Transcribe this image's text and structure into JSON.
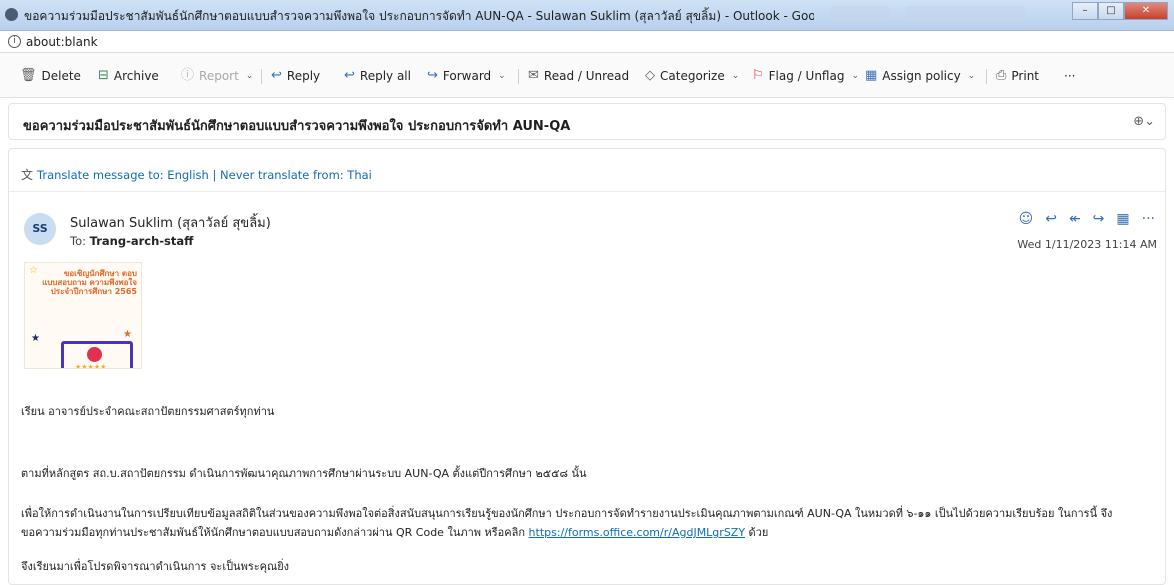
{
  "window": {
    "title": "ขอความร่วมมือประชาสัมพันธ์นักศึกษาตอบแบบสำรวจความพึงพอใจ ประกอบการจัดทำ AUN-QA - Sulawan Suklim (สุลาวัลย์ สุขลิ้ม) - Outlook - Google Chrome",
    "url": "about:blank"
  },
  "toolbar": {
    "delete": "Delete",
    "archive": "Archive",
    "report": "Report",
    "reply": "Reply",
    "reply_all": "Reply all",
    "forward": "Forward",
    "read_unread": "Read / Unread",
    "categorize": "Categorize",
    "flag": "Flag / Unflag",
    "assign_policy": "Assign policy",
    "print": "Print",
    "more": "···"
  },
  "subject": "ขอความร่วมมือประชาสัมพันธ์นักศึกษาตอบแบบสำรวจความพึงพอใจ ประกอบการจัดทำ AUN-QA",
  "translate": {
    "prefix": "Translate message to: English",
    "separator": " | ",
    "never": "Never translate from: Thai"
  },
  "message": {
    "avatar_initials": "SS",
    "sender": "Sulawan Suklim (สุลาวัลย์ สุขลิ้ม)",
    "to_label": "To:",
    "to": "Trang-arch-staff",
    "date": "Wed 1/11/2023 11:14 AM",
    "poster_text": "ขอเชิญนักศึกษา ตอบแบบสอบถาม ความพึงพอใจ ประจำปีการศึกษา 2565",
    "greeting": "เรียน อาจารย์ประจำคณะสถาปัตยกรรมศาสตร์ทุกท่าน",
    "para1": "ตามที่หลักสูตร สถ.บ.สถาปัตยกรรม ดำเนินการพัฒนาคุณภาพการศึกษาผ่านระบบ AUN-QA ตั้งแต่ปีการศึกษา ๒๕๕๘ นั้น",
    "para2_line1": "เพื่อให้การดำเนินงานในการเปรียบเทียบข้อมูลสถิติในส่วนของความพึงพอใจต่อสิ่งสนับสนุนการเรียนรู้ของนักศึกษา ประกอบการจัดทำรายงานประเมินคุณภาพตามเกณฑ์ AUN-QA ในหมวดที่ ๖-๑๑ เป็นไปด้วยความเรียบร้อย ในการนี้ จึง",
    "para2_line2_prefix": "ขอความร่วมมือทุกท่านประชาสัมพันธ์ให้นักศึกษาตอบแบบสอบถามดังกล่าวผ่าน QR Code ในภาพ หรือคลิก",
    "link": "https://forms.office.com/r/AgdJMLgrSZY",
    "para2_line2_suffix": " ด้วย",
    "closing": "จึงเรียนมาเพื่อโปรดพิจารณาดำเนินการ จะเป็นพระคุณยิ่ง"
  },
  "colors": {
    "accent": "#0f6cbd",
    "flag": "#d13438"
  }
}
